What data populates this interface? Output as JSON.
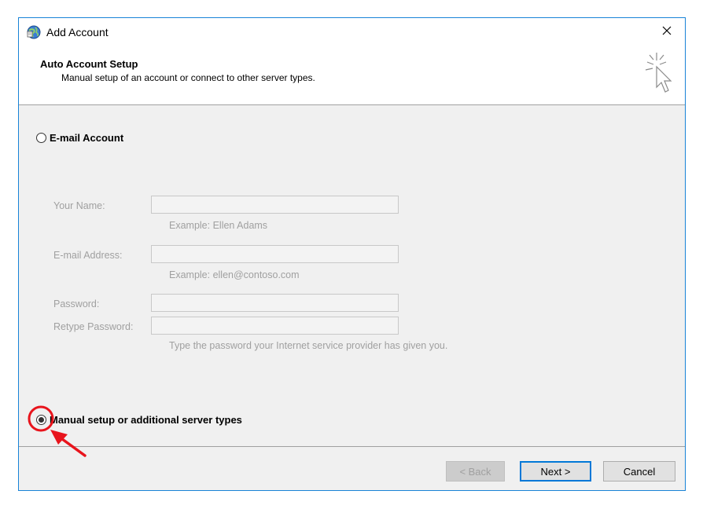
{
  "window": {
    "title": "Add Account",
    "app_icon": "outlook-globe-icon",
    "close_icon": "close-icon"
  },
  "header": {
    "title": "Auto Account Setup",
    "subtitle": "Manual setup of an account or connect to other server types.",
    "icon": "sparkle-cursor-icon"
  },
  "options": {
    "email_account": {
      "label": "E-mail Account",
      "selected": false
    },
    "manual_setup": {
      "label": "Manual setup or additional server types",
      "selected": true
    }
  },
  "form": {
    "your_name": {
      "label": "Your Name:",
      "value": "",
      "hint": "Example: Ellen Adams"
    },
    "email_address": {
      "label": "E-mail Address:",
      "value": "",
      "hint": "Example: ellen@contoso.com"
    },
    "password": {
      "label": "Password:",
      "value": ""
    },
    "retype_password": {
      "label": "Retype Password:",
      "value": "",
      "hint": "Type the password your Internet service provider has given you."
    }
  },
  "buttons": {
    "back": "< Back",
    "next": "Next >",
    "cancel": "Cancel"
  },
  "colors": {
    "window_border": "#1883d7",
    "annotation_red": "#e8141c",
    "default_button_border": "#0078d7"
  }
}
